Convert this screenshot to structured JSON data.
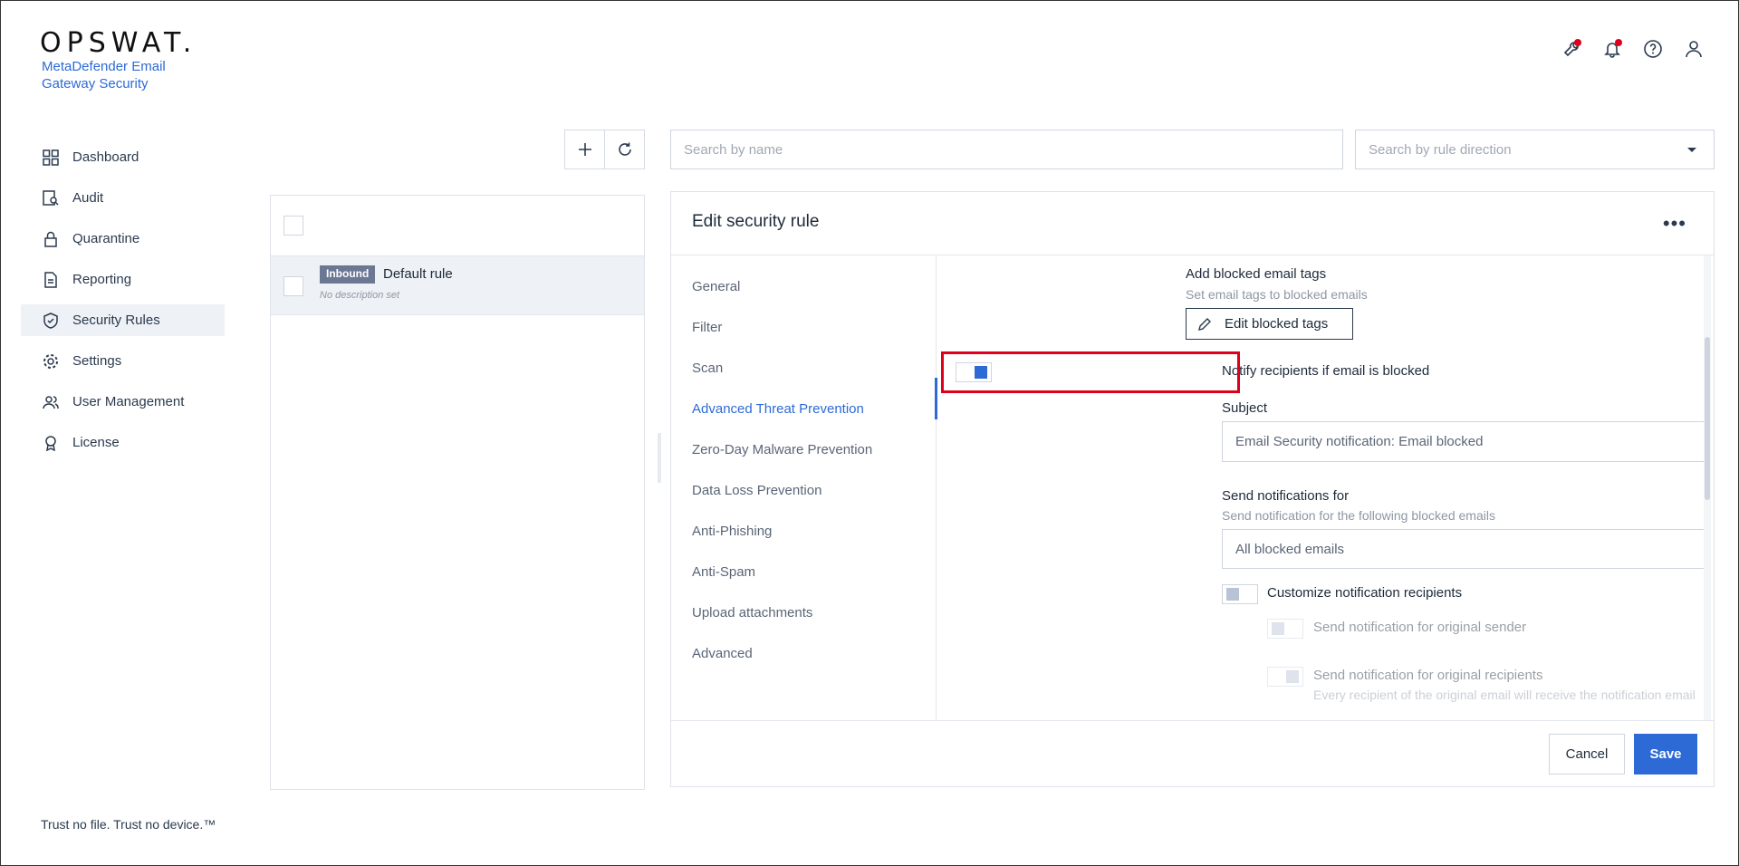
{
  "brand": {
    "logo": "OPSWAT.",
    "product": "MetaDefender Email Gateway Security",
    "tagline": "Trust no file. Trust no device.™"
  },
  "header_icons": [
    "wrench-icon",
    "bell-icon",
    "help-icon",
    "user-icon"
  ],
  "sidebar": {
    "items": [
      {
        "label": "Dashboard",
        "icon": "dashboard-icon"
      },
      {
        "label": "Audit",
        "icon": "audit-icon"
      },
      {
        "label": "Quarantine",
        "icon": "lock-icon"
      },
      {
        "label": "Reporting",
        "icon": "document-icon"
      },
      {
        "label": "Security Rules",
        "icon": "shield-check-icon",
        "active": true
      },
      {
        "label": "Settings",
        "icon": "gear-icon"
      },
      {
        "label": "User Management",
        "icon": "users-icon"
      },
      {
        "label": "License",
        "icon": "award-icon"
      }
    ]
  },
  "search": {
    "name_placeholder": "Search by name",
    "direction_placeholder": "Search by rule direction"
  },
  "rules": [
    {
      "direction": "Inbound",
      "name": "Default rule",
      "description": "No description set"
    }
  ],
  "edit": {
    "title": "Edit security rule",
    "more": "•••",
    "sections": [
      "General",
      "Filter",
      "Scan",
      "Advanced Threat Prevention",
      "Zero-Day Malware Prevention",
      "Data Loss Prevention",
      "Anti-Phishing",
      "Anti-Spam",
      "Upload attachments",
      "Advanced"
    ],
    "active_section": "Advanced Threat Prevention",
    "content": {
      "blocked_tags_title": "Add blocked email tags",
      "blocked_tags_sub": "Set email tags to blocked emails",
      "edit_tags_button": "Edit blocked tags",
      "notify_label": "Notify recipients if email is blocked",
      "notify_on": true,
      "subject_label": "Subject",
      "subject_value": "Email Security notification: Email blocked",
      "send_for_label": "Send notifications for",
      "send_for_sub": "Send notification for the following blocked emails",
      "send_for_value": "All blocked emails",
      "customize_label": "Customize notification recipients",
      "customize_on": false,
      "orig_sender_label": "Send notification for original sender",
      "orig_recipients_label": "Send notification for original recipients",
      "orig_recipients_sub": "Every recipient of the original email will receive the notification email"
    },
    "cancel": "Cancel",
    "save": "Save"
  },
  "colors": {
    "accent": "#2d6ad6",
    "highlight": "#e0001b",
    "badge": "#6b7894"
  }
}
